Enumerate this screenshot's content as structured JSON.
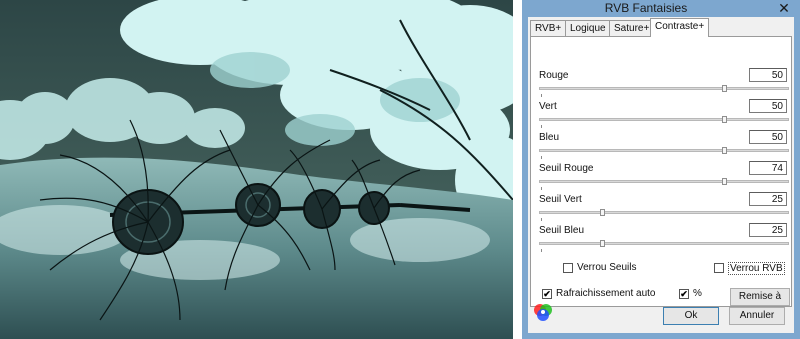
{
  "dialog": {
    "title": "RVB Fantaisies",
    "close_glyph": "✕",
    "tabs": [
      {
        "label": "RVB+",
        "active": false
      },
      {
        "label": "Logique",
        "active": false
      },
      {
        "label": "Sature+",
        "active": false
      },
      {
        "label": "Contraste+",
        "active": true
      }
    ],
    "sliders": [
      {
        "label": "Rouge",
        "value": "50",
        "level": 0.74
      },
      {
        "label": "Vert",
        "value": "50",
        "level": 0.74
      },
      {
        "label": "Bleu",
        "value": "50",
        "level": 0.74
      },
      {
        "label": "Seuil Rouge",
        "value": "74",
        "level": 0.74
      },
      {
        "label": "Seuil Vert",
        "value": "25",
        "level": 0.25
      },
      {
        "label": "Seuil Bleu",
        "value": "25",
        "level": 0.25
      }
    ],
    "lock_thresholds_label": "Verrou Seuils",
    "lock_thresholds_checked": false,
    "lock_rvb_label": "Verrou RVB",
    "lock_rvb_checked": false,
    "auto_refresh_label": "Rafraichissement auto",
    "auto_refresh_checked": true,
    "percent_label": "%",
    "percent_checked": true,
    "reset_label": "Remise à Zéro",
    "ok_label": "Ok",
    "cancel_label": "Annuler",
    "check_glyph": "✔"
  },
  "colors": {
    "titlebar": "#7da7cf",
    "window_bg": "#f0f0f0",
    "photo_sky": "#24393a",
    "photo_foliage": "#c9f0f0"
  },
  "icons": {
    "rgb_logo": "rgb-circles-icon",
    "close": "close-icon",
    "photo": "infrared-hay-rake-photo"
  }
}
